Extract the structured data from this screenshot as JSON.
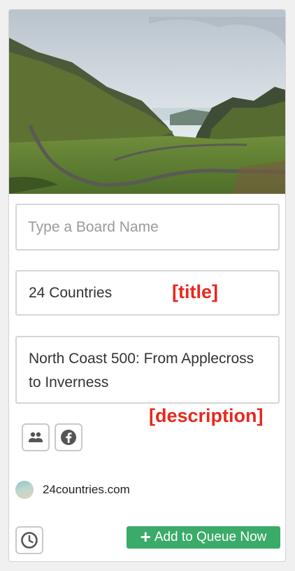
{
  "board_input": {
    "placeholder": "Type a Board Name",
    "value": ""
  },
  "title": {
    "value": "24 Countries",
    "tag": "[title]"
  },
  "description": {
    "value": "North Coast 500: From Applecross to Inverness",
    "tag": "[description]"
  },
  "share_buttons": [
    "group-icon",
    "facebook-icon"
  ],
  "source": {
    "domain": "24countries.com"
  },
  "actions": {
    "schedule_icon": "clock-icon",
    "queue_label": "Add to Queue Now",
    "queue_icon": "plus-icon"
  },
  "colors": {
    "accent_green": "#3bab69",
    "tag_red": "#e8281e",
    "field_border": "#d6d6d6"
  }
}
